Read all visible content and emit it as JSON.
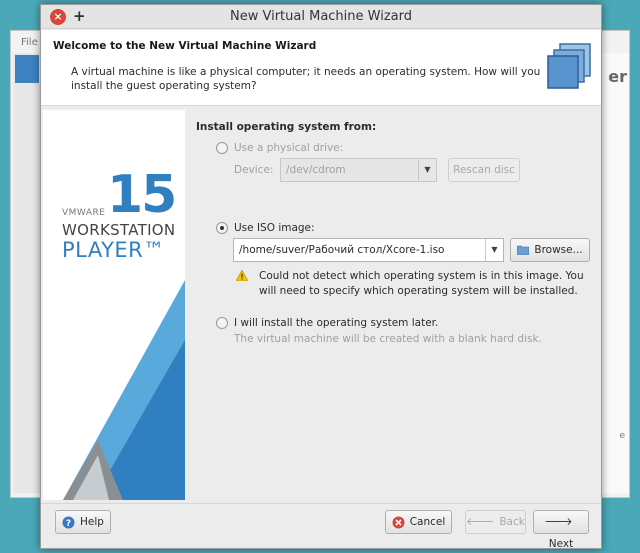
{
  "background_window": {
    "menu": "File",
    "right_letter": "er",
    "right_small": "e"
  },
  "window": {
    "title": "New Virtual Machine Wizard"
  },
  "header": {
    "title": "Welcome to the New Virtual Machine Wizard",
    "description": "A virtual machine is like a physical computer; it needs an operating system. How will you install the guest operating system?"
  },
  "banner": {
    "version": "15",
    "brand": "VMWARE",
    "product_line1": "WORKSTATION",
    "product_line2": "PLAYER™"
  },
  "install": {
    "heading": "Install operating system from:",
    "physical": {
      "label": "Use a physical drive:",
      "device_label": "Device:",
      "device_value": "/dev/cdrom",
      "rescan_label": "Rescan disc",
      "selected": false,
      "enabled": false
    },
    "iso": {
      "label": "Use ISO image:",
      "path": "/home/suver/Рабочий стол/Xcore-1.iso",
      "browse_label": "Browse...",
      "selected": true,
      "warning": "Could not detect which operating system is in this image. You will need to specify which operating system will be installed."
    },
    "later": {
      "label": "I will install the operating system later.",
      "description": "The virtual machine will be created with a blank hard disk.",
      "selected": false
    }
  },
  "footer": {
    "help": "Help",
    "cancel": "Cancel",
    "back": "Back",
    "next": "Next"
  },
  "colors": {
    "accent": "#2f7fc1",
    "close": "#d9453b",
    "warning": "#f2c200"
  }
}
